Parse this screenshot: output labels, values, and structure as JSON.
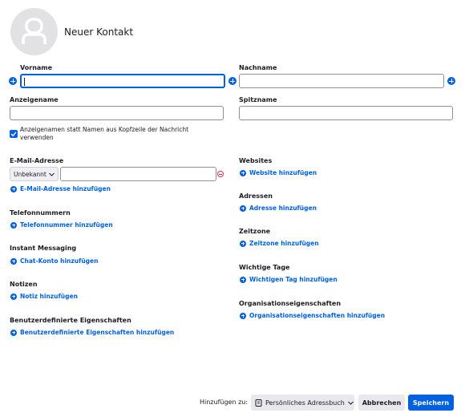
{
  "header": {
    "title": "Neuer Kontakt",
    "avatar_icon": "person-icon"
  },
  "name": {
    "first_label": "Vorname",
    "first_value": "",
    "last_label": "Nachname",
    "last_value": "",
    "display_label": "Anzeigename",
    "display_value": "",
    "nick_label": "Spitzname",
    "nick_value": "",
    "prefer_display_label": "Anzeigenamen statt Namen aus Kopfzeile der Nachricht verwenden",
    "prefer_display_checked": true
  },
  "email": {
    "label": "E-Mail-Adresse",
    "type": "Unbekannt",
    "value": "",
    "add_label": "E-Mail-Adresse hinzufügen"
  },
  "phone": {
    "label": "Telefonnummern",
    "add_label": "Telefonnummer hinzufügen"
  },
  "im": {
    "label": "Instant Messaging",
    "add_label": "Chat-Konto hinzufügen"
  },
  "notes": {
    "label": "Notizen",
    "add_label": "Notiz hinzufügen"
  },
  "custom": {
    "label": "Benutzerdefinierte Eigenschaften",
    "add_label": "Benutzerdefinierte Eigenschaften hinzufügen"
  },
  "websites": {
    "label": "Websites",
    "add_label": "Website hinzufügen"
  },
  "addresses": {
    "label": "Adressen",
    "add_label": "Adresse hinzufügen"
  },
  "timezone": {
    "label": "Zeitzone",
    "add_label": "Zeitzone hinzufügen"
  },
  "dates": {
    "label": "Wichtige Tage",
    "add_label": "Wichtigen Tag hinzufügen"
  },
  "org": {
    "label": "Organisationseigenschaften",
    "add_label": "Organisationseigenschaften hinzufügen"
  },
  "footer": {
    "add_to_label": "Hinzufügen zu:",
    "addressbook": "Persönliches Adressbuch",
    "cancel_label": "Abbrechen",
    "save_label": "Speichern"
  },
  "colors": {
    "accent": "#0061e0",
    "danger": "#e22850",
    "border": "#8f8f9d"
  }
}
